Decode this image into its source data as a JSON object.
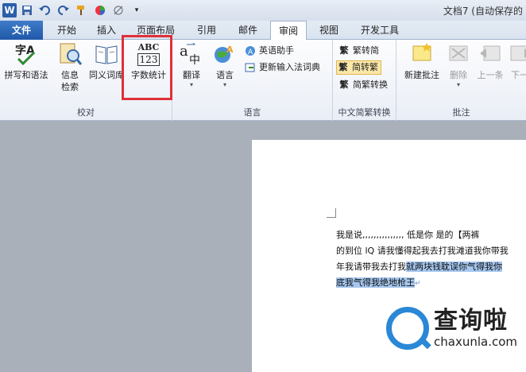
{
  "app": {
    "window_title": "文档7 (自动保存的",
    "qat_icons": [
      "word-icon",
      "save-icon",
      "undo-icon",
      "redo-icon",
      "format-painter-icon",
      "color-icon",
      "draw-icon",
      "customize-icon"
    ],
    "word_letter": "W"
  },
  "tabs": [
    {
      "label": "文件"
    },
    {
      "label": "开始"
    },
    {
      "label": "插入"
    },
    {
      "label": "页面布局"
    },
    {
      "label": "引用"
    },
    {
      "label": "邮件"
    },
    {
      "label": "审阅"
    },
    {
      "label": "视图"
    },
    {
      "label": "开发工具"
    }
  ],
  "ribbon": {
    "proofing": {
      "label": "校对",
      "spelling": "拼写和语法",
      "research": "信息\n检索",
      "thesaurus": "同义词库",
      "wordcount": "字数统计",
      "wordcount_icon_top": "ABC",
      "wordcount_icon_bottom": "123"
    },
    "language": {
      "label": "语言",
      "translate": "翻译",
      "language": "语言",
      "english_assistant": "英语助手",
      "update_ime": "更新输入法词典"
    },
    "chinese": {
      "label": "中文简繁转换",
      "to_traditional": "繁转简",
      "to_simplified": "简转繁",
      "convert": "简繁转换"
    },
    "comments": {
      "label": "批注",
      "new_comment": "新建批注",
      "delete": "删除",
      "previous": "上一条",
      "next": "下一"
    }
  },
  "document": {
    "line1": "我是说,,,,,,,,,,,,,,, 低是你  是的【两裤",
    "line2": "的到位 lQ 请我懂得起我去打我滩道我你带我",
    "line3_plain": "年我请带我去打我",
    "line3_sel": "就两块钱耽误你气得我你",
    "line4_sel": "底我气得我绝地枪王",
    "enter_mark": "↵"
  },
  "watermark": {
    "cn": "查询啦",
    "en": "chaxunla.com"
  },
  "colors": {
    "accent": "#2a5ea8",
    "highlight": "#e0303a",
    "selection": "#a6c7ef",
    "watermark": "#2a88d6"
  }
}
